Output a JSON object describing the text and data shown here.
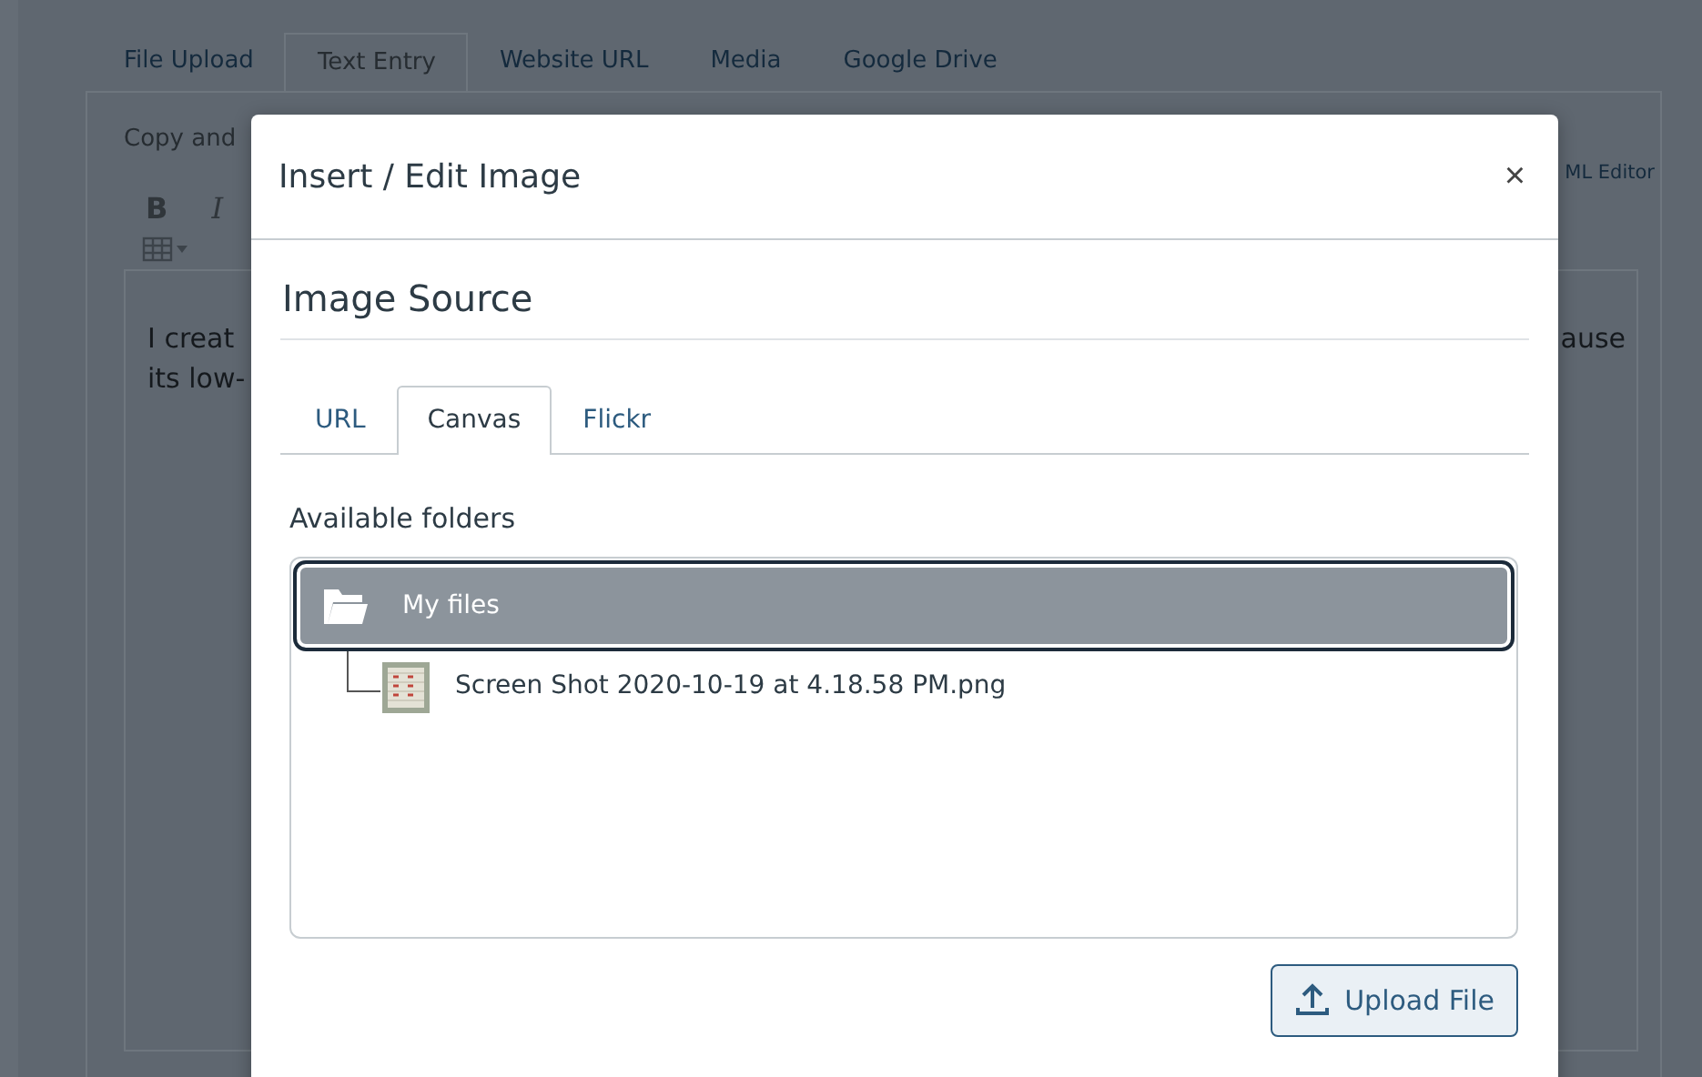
{
  "background": {
    "tabs": [
      {
        "label": "File Upload",
        "selected": false
      },
      {
        "label": "Text Entry",
        "selected": true
      },
      {
        "label": "Website URL",
        "selected": false
      },
      {
        "label": "Media",
        "selected": false
      },
      {
        "label": "Google Drive",
        "selected": false
      }
    ],
    "intro": "Copy and",
    "html_editor_link": "ML Editor",
    "toolbar": {
      "bold": "B",
      "italic": "I"
    },
    "editor_lines": [
      "I creat",
      "its low-"
    ],
    "editor_right_text": "ause"
  },
  "dialog": {
    "title": "Insert / Edit Image",
    "close": "×",
    "heading": "Image Source",
    "tabs": [
      {
        "label": "URL",
        "selected": false
      },
      {
        "label": "Canvas",
        "selected": true
      },
      {
        "label": "Flickr",
        "selected": false
      }
    ],
    "folders_label": "Available folders",
    "tree": {
      "name": "My files",
      "selected": true,
      "expanded": true,
      "children": [
        {
          "name": "Screen Shot 2020-10-19 at 4.18.58 PM.png",
          "selected": false
        }
      ]
    },
    "upload_button": "Upload File"
  }
}
